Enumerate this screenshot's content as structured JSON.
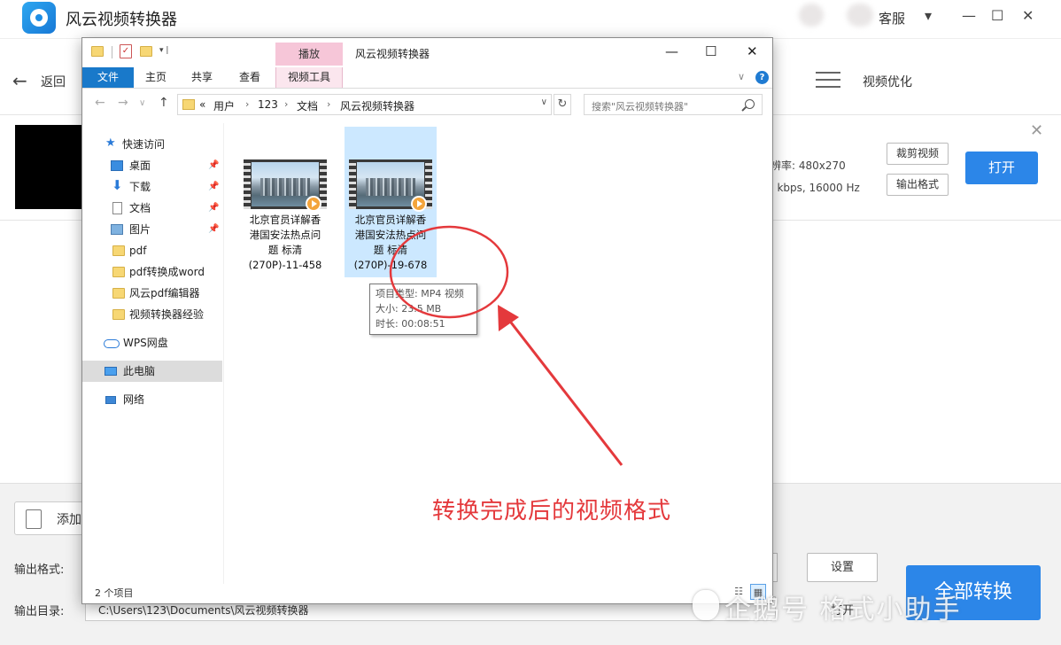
{
  "app": {
    "title": "风云视频转换器",
    "support_label": "客服",
    "back_label": "返回",
    "optimize_label": "视频优化",
    "file_row": {
      "resolution_text": "辨率: 480x270",
      "bitrate_text": "2 kbps, 16000 Hz",
      "crop_btn": "裁剪视频",
      "output_fmt_btn": "输出格式",
      "open_btn": "打开"
    },
    "bottom": {
      "add_label": "添加",
      "output_format_label": "输出格式:",
      "settings_btn": "设置",
      "output_dir_label": "输出目录:",
      "output_dir_value": "C:\\Users\\123\\Documents\\风云视频转换器",
      "open_dir_label": "打开",
      "convert_all_label": "全部转换"
    }
  },
  "explorer": {
    "window_title": "风云视频转换器",
    "context_tab_top": "播放",
    "ribbon_tabs": [
      "文件",
      "主页",
      "共享",
      "查看",
      "视频工具"
    ],
    "breadcrumb_prefix": "«",
    "breadcrumb": [
      "用户",
      "123",
      "文档",
      "风云视频转换器"
    ],
    "search_placeholder": "搜索\"风云视频转换器\"",
    "nav": [
      {
        "label": "快速访问"
      },
      {
        "label": "桌面"
      },
      {
        "label": "下载"
      },
      {
        "label": "文档"
      },
      {
        "label": "图片"
      },
      {
        "label": "pdf"
      },
      {
        "label": "pdf转换成word"
      },
      {
        "label": "风云pdf编辑器"
      },
      {
        "label": "视频转换器经验"
      },
      {
        "label": "WPS网盘"
      },
      {
        "label": "此电脑"
      },
      {
        "label": "网络"
      }
    ],
    "files": [
      {
        "lines": [
          "北京官员详解香",
          "港国安法热点问",
          "题 标清",
          "(270P)-11-458"
        ]
      },
      {
        "lines": [
          "北京官员详解香",
          "港国安法热点问",
          "题 标清",
          "(270P)-19-678"
        ]
      }
    ],
    "tooltip": [
      "项目类型: MP4 视频",
      "大小: 23.5 MB",
      "时长: 00:08:51"
    ],
    "status_count": "2 个项目"
  },
  "annotation": {
    "text": "转换完成后的视频格式",
    "color": "#e4393c"
  },
  "watermark": "企鹅号 格式小助手",
  "colors": {
    "accent": "#2c86e8",
    "ribbon_file": "#1979ca",
    "context_tab": "#f6c6d8",
    "selection": "#cce8ff"
  }
}
